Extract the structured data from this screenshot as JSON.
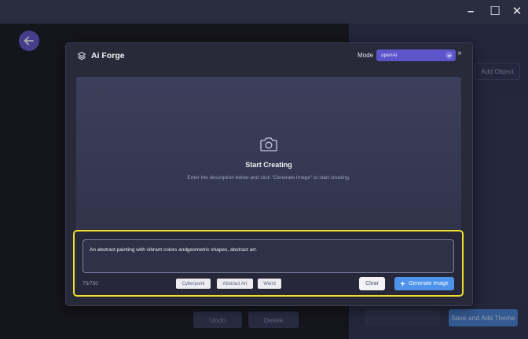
{
  "window": {
    "minimize_glyph": "–",
    "maximize_glyph": "☐",
    "close_glyph": "✕"
  },
  "background": {
    "add_object_label": "Add Object",
    "undo_label": "Undo",
    "delete_label": "Delete",
    "save_theme_label": "Save and Add Theme"
  },
  "modal": {
    "title": "Ai Forge",
    "mode_label": "Mode",
    "mode_value": "openAi",
    "close_glyph": "×",
    "empty_state": {
      "title": "Start Creating",
      "description": "Enter the description below and click \"Generate Image\" to start creating."
    },
    "prompt": {
      "value": "An abstract painting with vibrant colors andgeometric shapes, abstract art.",
      "char_count": "75/750",
      "tags": [
        "Cyberpunk",
        "Abstract Art",
        "Weird"
      ],
      "clear_label": "Clear",
      "generate_label": "Generate Image"
    }
  },
  "colors": {
    "accent_purple": "#6a5ad0",
    "generate_blue": "#4d93ec",
    "highlight_yellow": "#f0df2a"
  },
  "icons": {
    "back": "arrow-left-icon",
    "logo": "layers-icon",
    "camera": "camera-icon",
    "caret": "chevron-down-icon",
    "generate": "sparkle-icon"
  }
}
